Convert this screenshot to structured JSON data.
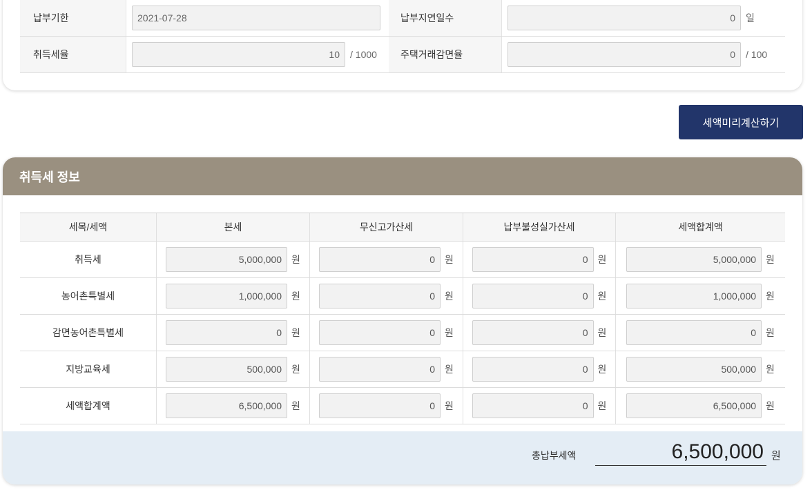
{
  "top_form": {
    "rows": [
      {
        "label1": "납부기한",
        "value1": "2021-07-28",
        "unit1": "",
        "label2": "납부지연일수",
        "value2": "0",
        "unit2": "일"
      },
      {
        "label1": "취득세율",
        "value1": "10",
        "unit1": "/ 1000",
        "label2": "주택거래감면율",
        "value2": "0",
        "unit2": "/ 100"
      }
    ]
  },
  "calc_button": {
    "label": "세액미리계산하기"
  },
  "info": {
    "title": "취득세 정보",
    "headers": [
      "세목/세액",
      "본세",
      "무신고가산세",
      "납부불성실가산세",
      "세액합계액"
    ],
    "unit": "원",
    "rows": [
      {
        "name": "취득세",
        "values": [
          "5,000,000",
          "0",
          "0",
          "5,000,000"
        ]
      },
      {
        "name": "농어촌특별세",
        "values": [
          "1,000,000",
          "0",
          "0",
          "1,000,000"
        ]
      },
      {
        "name": "감면농어촌특별세",
        "values": [
          "0",
          "0",
          "0",
          "0"
        ]
      },
      {
        "name": "지방교육세",
        "values": [
          "500,000",
          "0",
          "0",
          "500,000"
        ]
      },
      {
        "name": "세액합계액",
        "values": [
          "6,500,000",
          "0",
          "0",
          "6,500,000"
        ]
      }
    ],
    "total": {
      "label": "총납부세액",
      "value": "6,500,000",
      "unit": "원"
    }
  }
}
